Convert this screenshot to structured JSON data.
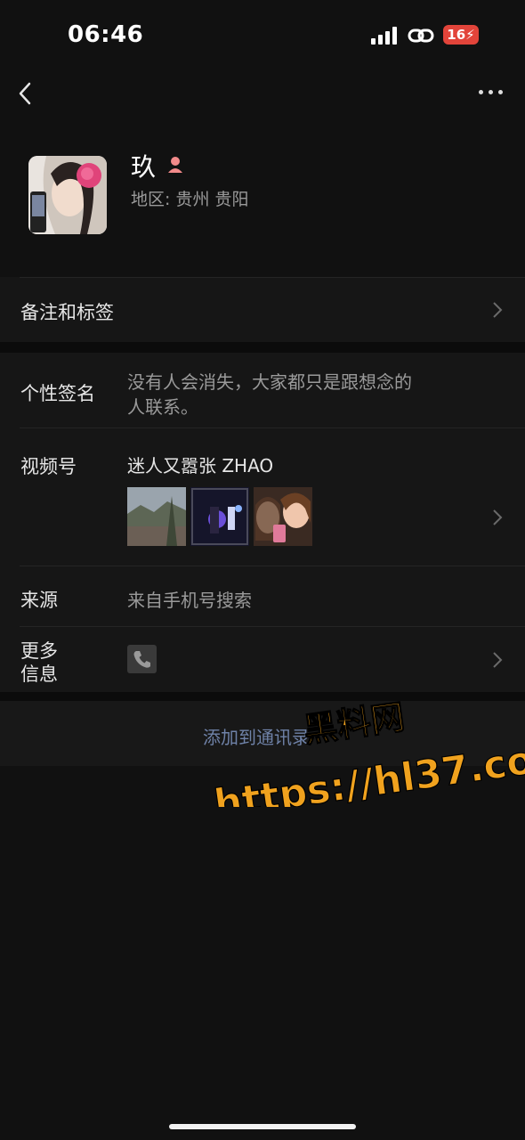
{
  "status": {
    "time": "06:46",
    "battery": "16"
  },
  "nav": {
    "back_icon": "chevron-left-icon",
    "more_icon": "ellipsis-icon"
  },
  "profile": {
    "name": "玖",
    "region": "地区: 贵州 贵阳",
    "gender_icon": "female-icon",
    "gender_color": "#f28a8a"
  },
  "rows": {
    "remark_tags": "备注和标签",
    "signature_label": "个性签名",
    "signature_line1": "没有人会消失，大家都只是跟想念的",
    "signature_line2": "人联系。",
    "channels_label": "视频号",
    "channels_value": "迷人又嚣张 ZHAO",
    "source_label": "来源",
    "source_value": "来自手机号搜索",
    "more_info_line1": "更多",
    "more_info_line2": "信息"
  },
  "actions": {
    "add_contact": "添加到通讯录"
  },
  "watermark": {
    "line1": "黑料网",
    "line2": "https://hl37.co",
    "color": "#f0a21e"
  }
}
